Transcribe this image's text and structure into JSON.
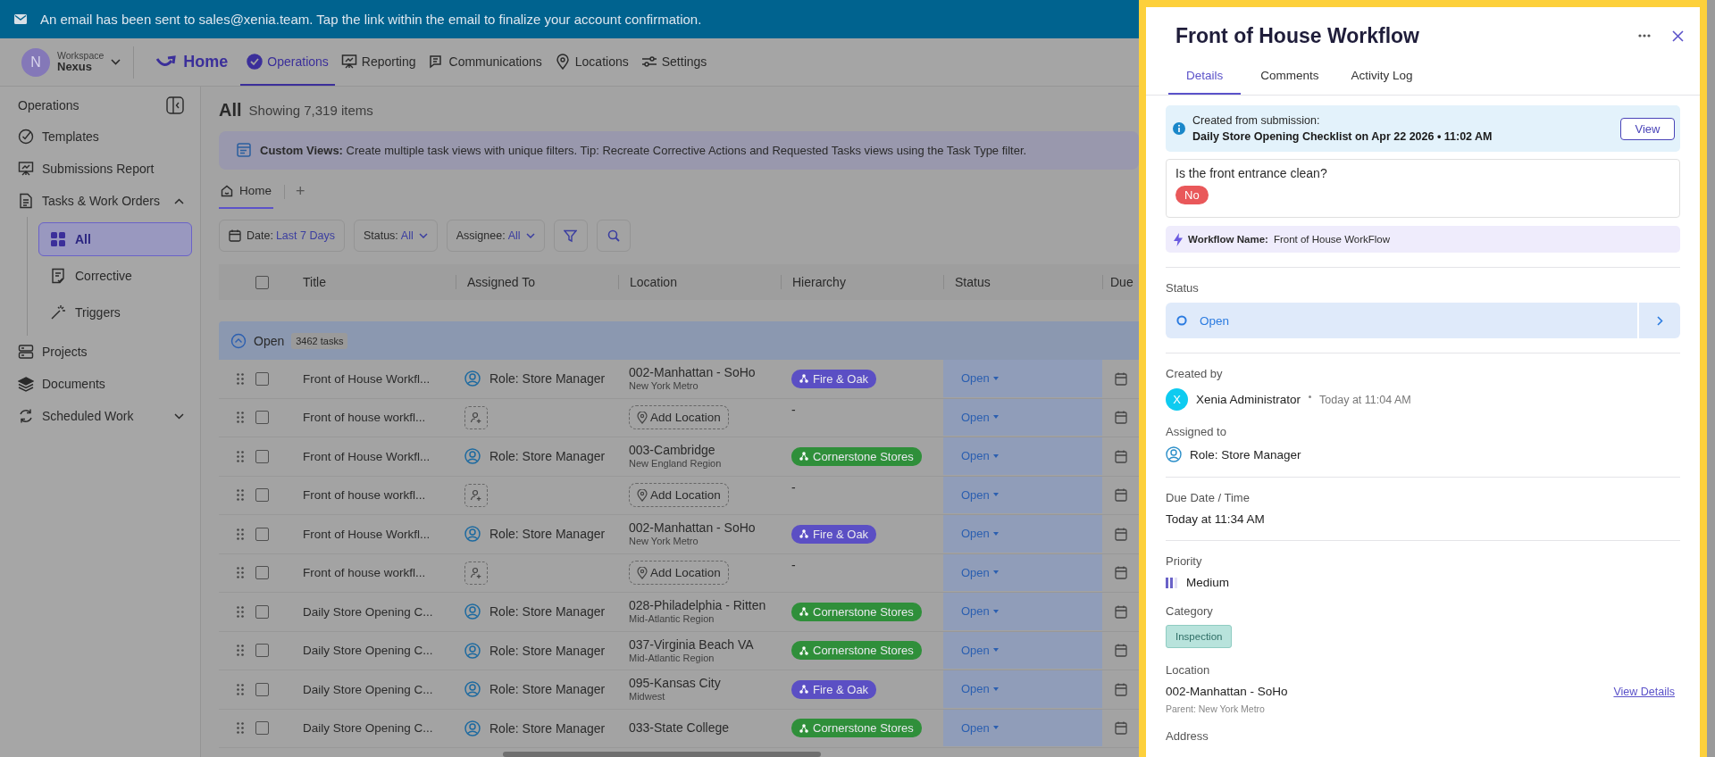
{
  "banner": {
    "text": "An email has been sent to sales@xenia.team. Tap the link within the email to finalize your account confirmation."
  },
  "nav": {
    "workspace": {
      "avatar": "N",
      "label": "Workspace",
      "name": "Nexus"
    },
    "home": "Home",
    "tabs": [
      {
        "label": "Operations",
        "selected": true
      },
      {
        "label": "Reporting",
        "selected": false
      },
      {
        "label": "Communications",
        "selected": false
      },
      {
        "label": "Locations",
        "selected": false
      },
      {
        "label": "Settings",
        "selected": false
      }
    ]
  },
  "sidebar": {
    "title": "Operations",
    "items": [
      {
        "label": "Templates",
        "selected": false
      },
      {
        "label": "Submissions Report",
        "selected": false
      },
      {
        "label": "Tasks & Work Orders",
        "selected": false,
        "expanded": true,
        "children": [
          {
            "label": "All",
            "selected": true
          },
          {
            "label": "Corrective",
            "selected": false
          },
          {
            "label": "Triggers",
            "selected": false
          }
        ]
      },
      {
        "label": "Projects",
        "selected": false
      },
      {
        "label": "Documents",
        "selected": false
      },
      {
        "label": "Scheduled Work",
        "selected": false,
        "expanded": false
      }
    ]
  },
  "main": {
    "title": "All",
    "count": "Showing 7,319 items",
    "tip": "**Custom Views:** Create multiple task views with unique filters. Tip: Recreate Corrective Actions and Requested Tasks views using the Task Type filter.",
    "view_tabs": [
      {
        "label": "Home",
        "selected": true
      }
    ],
    "add_tab": "+",
    "filters": [
      {
        "kind": "date",
        "label": "Date:",
        "value": "Last 7 Days"
      },
      {
        "kind": "select",
        "label": "Status:",
        "value": "All"
      },
      {
        "kind": "select",
        "label": "Assignee:",
        "value": "All"
      }
    ],
    "select_all_checked": false,
    "columns": [
      "Title",
      "Assigned To",
      "Location",
      "Hierarchy",
      "Status",
      "Due"
    ],
    "group": {
      "label": "Open",
      "count": "3462 tasks",
      "expanded": true
    },
    "rows": [
      {
        "checked": false,
        "title": "Front of House Workfl...",
        "assignee": "Role: Store Manager",
        "location": {
          "kind": "place",
          "name": "002-Manhattan - SoHo",
          "region": "New York Metro"
        },
        "hierarchy": {
          "kind": "tag",
          "label": "Fire & Oak",
          "color": "#5b4fc4"
        },
        "status": "Open"
      },
      {
        "checked": false,
        "title": "Front of house workfl...",
        "assignee": null,
        "location": {
          "kind": "add",
          "label": "Add Location"
        },
        "hierarchy": {
          "kind": "none",
          "label": "-"
        },
        "status": "Open"
      },
      {
        "checked": false,
        "title": "Front of House Workfl...",
        "assignee": "Role: Store Manager",
        "location": {
          "kind": "place",
          "name": "003-Cambridge",
          "region": "New England Region"
        },
        "hierarchy": {
          "kind": "tag",
          "label": "Cornerstone Stores",
          "color": "#2f8f3a"
        },
        "status": "Open"
      },
      {
        "checked": false,
        "title": "Front of house workfl...",
        "assignee": null,
        "location": {
          "kind": "add",
          "label": "Add Location"
        },
        "hierarchy": {
          "kind": "none",
          "label": "-"
        },
        "status": "Open"
      },
      {
        "checked": false,
        "title": "Front of House Workfl...",
        "assignee": "Role: Store Manager",
        "location": {
          "kind": "place",
          "name": "002-Manhattan - SoHo",
          "region": "New York Metro"
        },
        "hierarchy": {
          "kind": "tag",
          "label": "Fire & Oak",
          "color": "#5b4fc4"
        },
        "status": "Open"
      },
      {
        "checked": false,
        "title": "Front of house workfl...",
        "assignee": null,
        "location": {
          "kind": "add",
          "label": "Add Location"
        },
        "hierarchy": {
          "kind": "none",
          "label": "-"
        },
        "status": "Open"
      },
      {
        "checked": false,
        "title": "Daily Store Opening C...",
        "assignee": "Role: Store Manager",
        "location": {
          "kind": "place",
          "name": "028-Philadelphia - Ritten",
          "region": "Mid-Atlantic Region"
        },
        "hierarchy": {
          "kind": "tag",
          "label": "Cornerstone Stores",
          "color": "#2f8f3a"
        },
        "status": "Open"
      },
      {
        "checked": false,
        "title": "Daily Store Opening C...",
        "assignee": "Role: Store Manager",
        "location": {
          "kind": "place",
          "name": "037-Virginia Beach VA",
          "region": "Mid-Atlantic Region"
        },
        "hierarchy": {
          "kind": "tag",
          "label": "Cornerstone Stores",
          "color": "#2f8f3a"
        },
        "status": "Open"
      },
      {
        "checked": false,
        "title": "Daily Store Opening C...",
        "assignee": "Role: Store Manager",
        "location": {
          "kind": "place",
          "name": "095-Kansas City",
          "region": "Midwest"
        },
        "hierarchy": {
          "kind": "tag",
          "label": "Fire & Oak",
          "color": "#5b4fc4"
        },
        "status": "Open"
      },
      {
        "checked": false,
        "title": "Daily Store Opening C...",
        "assignee": "Role: Store Manager",
        "location": {
          "kind": "place",
          "name": "033-State College"
        },
        "hierarchy": {
          "kind": "tag",
          "label": "Cornerstone Stores",
          "color": "#2f8f3a"
        },
        "status": "Open"
      }
    ]
  },
  "panel": {
    "title": "Front of House Workflow",
    "tabs": [
      {
        "label": "Details",
        "selected": true
      },
      {
        "label": "Comments",
        "selected": false
      },
      {
        "label": "Activity Log",
        "selected": false
      }
    ],
    "info": {
      "heading": "Created from submission:",
      "detail": "Daily Store Opening Checklist on Apr 22 2026 • 11:02 AM",
      "button": "View"
    },
    "question": {
      "text": "Is the front entrance clean?",
      "answer": "No"
    },
    "workflow": {
      "label": "Workflow Name:",
      "value": "Front of House WorkFlow"
    },
    "status": {
      "label": "Status",
      "value": "Open"
    },
    "created_by": {
      "label": "Created by",
      "avatar": "X",
      "name": "Xenia Administrator",
      "time": "Today at 11:04 AM"
    },
    "assigned": {
      "label": "Assigned to",
      "value": "Role: Store Manager"
    },
    "due": {
      "label": "Due Date / Time",
      "value": "Today at 11:34 AM"
    },
    "priority": {
      "label": "Priority",
      "value": "Medium"
    },
    "category": {
      "label": "Category",
      "value": "Inspection"
    },
    "location": {
      "label": "Location",
      "name": "002-Manhattan - SoHo",
      "parent": "Parent: New York Metro",
      "link": "View Details"
    },
    "address": {
      "label": "Address"
    }
  }
}
